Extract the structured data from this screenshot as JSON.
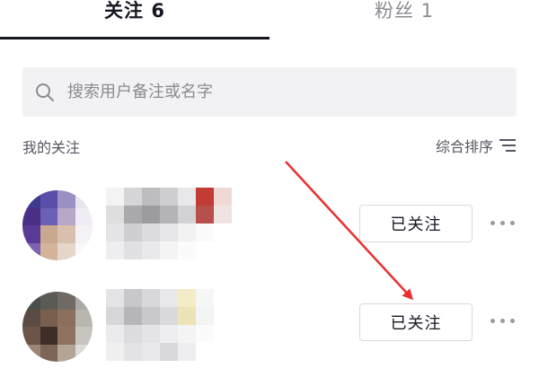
{
  "tabs": {
    "following_label": "关注 6",
    "fans_label": "粉丝 1"
  },
  "search": {
    "placeholder": "搜索用户备注或名字",
    "value": ""
  },
  "section": {
    "title": "我的关注",
    "sort_label": "综合排序"
  },
  "users": [
    {
      "follow_label": "已关注",
      "avatar_blurred": true,
      "name_blurred": true
    },
    {
      "follow_label": "已关注",
      "avatar_blurred": true,
      "name_blurred": true
    }
  ],
  "colors": {
    "primary_text": "#161823",
    "secondary_text": "#8a8b91",
    "search_bg": "#f2f2f4",
    "annotation_arrow": "#e8312f"
  },
  "icons": {
    "search": "search-icon",
    "sort": "sort-lines-icon",
    "more": "more-dots-icon"
  }
}
